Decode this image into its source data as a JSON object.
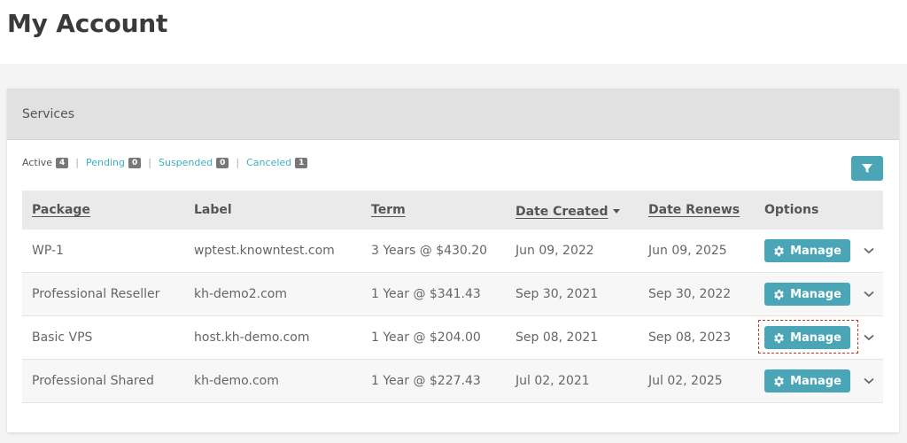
{
  "page": {
    "title": "My Account"
  },
  "panel": {
    "title": "Services"
  },
  "status_filters": [
    {
      "label": "Active",
      "count": "4",
      "active": true
    },
    {
      "label": "Pending",
      "count": "0",
      "active": false
    },
    {
      "label": "Suspended",
      "count": "0",
      "active": false
    },
    {
      "label": "Canceled",
      "count": "1",
      "active": false
    }
  ],
  "filter_button": {
    "icon": "filter-icon"
  },
  "table": {
    "columns": [
      "Package",
      "Label",
      "Term",
      "Date Created",
      "Date Renews",
      "Options"
    ],
    "rows": [
      {
        "package": "WP-1",
        "label": "wptest.knowntest.com",
        "term": "3 Years @ $430.20",
        "created": "Jun 09, 2022",
        "renews": "Jun 09, 2025"
      },
      {
        "package": "Professional Reseller",
        "label": "kh-demo2.com",
        "term": "1 Year @ $341.43",
        "created": "Sep 30, 2021",
        "renews": "Sep 30, 2022"
      },
      {
        "package": "Basic VPS",
        "label": "host.kh-demo.com",
        "term": "1 Year @ $204.00",
        "created": "Sep 08, 2021",
        "renews": "Sep 08, 2023"
      },
      {
        "package": "Professional Shared",
        "label": "kh-demo.com",
        "term": "1 Year @ $227.43",
        "created": "Jul 02, 2021",
        "renews": "Jul 02, 2025"
      }
    ],
    "manage_label": "Manage"
  },
  "colors": {
    "accent": "#4aa5b6",
    "link": "#3bb0c4",
    "highlight": "#c0392b"
  }
}
